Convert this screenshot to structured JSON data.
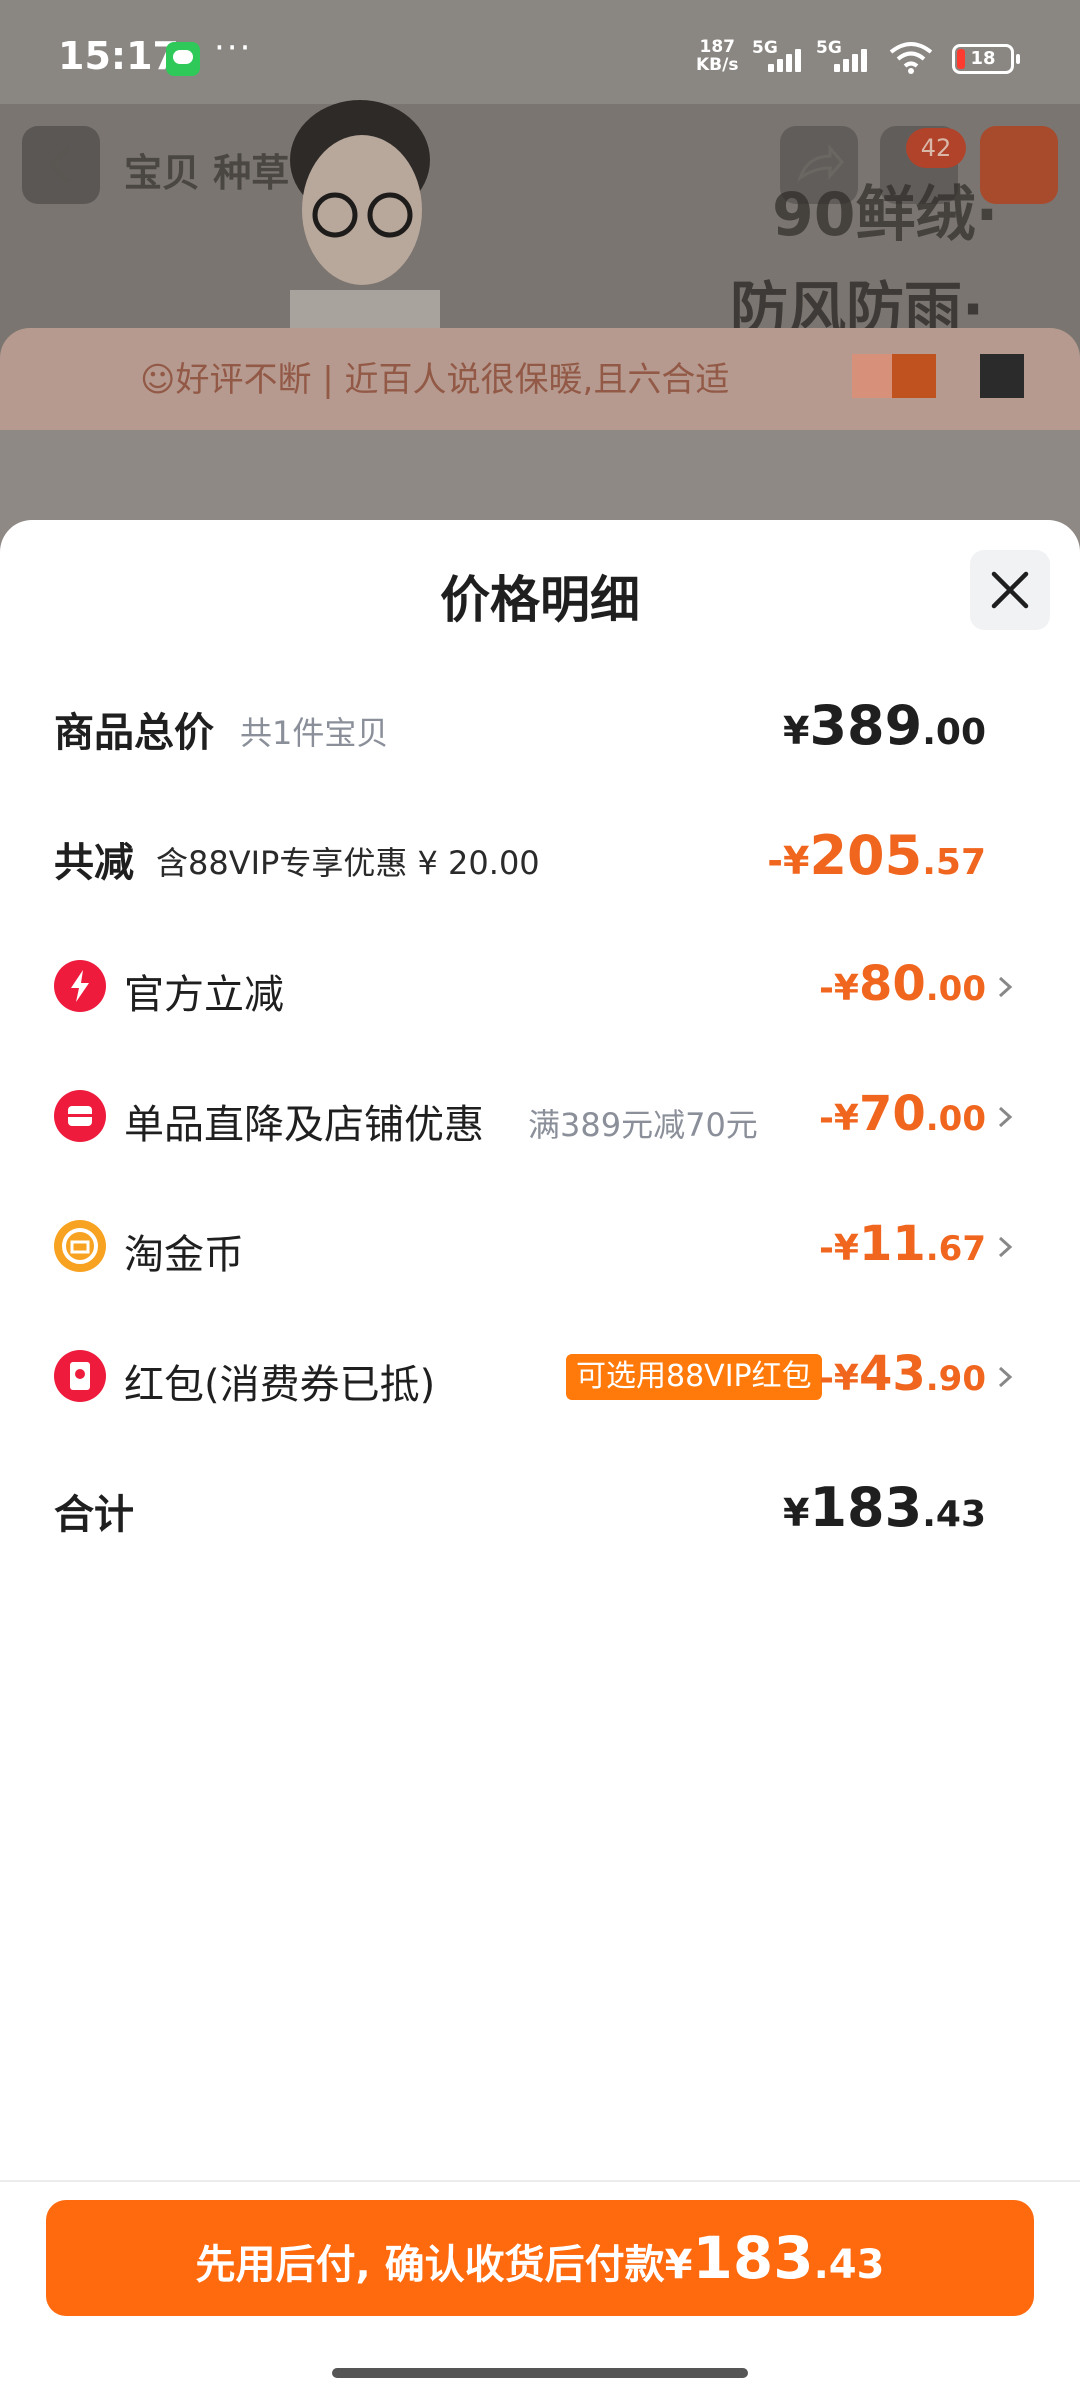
{
  "status_bar": {
    "time": "15:17",
    "dots": "···",
    "speed_top": "187",
    "speed_unit": "KB/s",
    "sig1": "5G",
    "sig2": "5G",
    "battery": "18"
  },
  "background": {
    "nav_tabs": "宝贝  种草",
    "cart_badge": "42",
    "promo_line1": "90鲜绒·",
    "promo_line2": "防风防雨·",
    "review_text": "☺好评不断 | 近百人说很保暖,且六合适"
  },
  "sheet": {
    "title": "价格明细",
    "total_label": "商品总价",
    "total_sub": "共1件宝贝",
    "total_price": {
      "cur": "¥",
      "int": "389",
      "dec": ".00"
    },
    "reduce_label": "共减",
    "reduce_sub": "含88VIP专享优惠 ¥ 20.00",
    "reduce_price": {
      "cur": "-¥",
      "int": "205",
      "dec": ".57"
    },
    "items": [
      {
        "label": "官方立减",
        "sub": "",
        "tag": "",
        "price": {
          "cur": "-¥",
          "int": "80",
          "dec": ".00"
        },
        "icon": "lightning-icon",
        "color": "#ee1b3c"
      },
      {
        "label": "单品直降及店铺优惠",
        "sub": "满389元减70元",
        "tag": "",
        "price": {
          "cur": "-¥",
          "int": "70",
          "dec": ".00"
        },
        "icon": "store-icon",
        "color": "#ee1b3c"
      },
      {
        "label": "淘金币",
        "sub": "",
        "tag": "",
        "price": {
          "cur": "-¥",
          "int": "11",
          "dec": ".67"
        },
        "icon": "coin-icon",
        "color": "#f7a321"
      },
      {
        "label": "红包(消费券已抵)",
        "sub": "",
        "tag": "可选用88VIP红包",
        "price": {
          "cur": "-¥",
          "int": "43",
          "dec": ".90"
        },
        "icon": "red-packet-icon",
        "color": "#ee1b3c"
      }
    ],
    "sum_label": "合计",
    "sum_price": {
      "cur": "¥",
      "int": "183",
      "dec": ".43"
    }
  },
  "footer": {
    "pay_text": "先用后付, 确认收货后付款",
    "pay_price": {
      "cur": "¥",
      "int": "183",
      "dec": ".43"
    }
  }
}
